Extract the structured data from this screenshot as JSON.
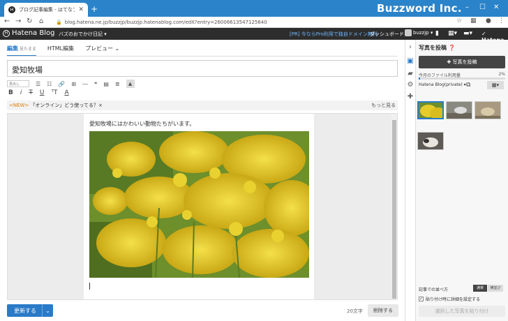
{
  "browser": {
    "tab_title": "ブログ記事編集 - はてなブログ",
    "new_tab": "+",
    "brand": "Buzzword Inc.",
    "url": "blog.hatena.ne.jp/buzzjp/buzzjp.hatenablog.com/edit?entry=26006613547125640"
  },
  "hatena": {
    "logo": "Hatena Blog",
    "blog_name": "バズのおでかけ日記 ▾",
    "pro_link": "[PR] 今ならPro利用で独自ドメイン無料",
    "dashboard": "ダッシュボード",
    "user": "buzzjp ▾",
    "brand": "Hatena"
  },
  "editor": {
    "tabs": [
      {
        "label": "編集",
        "sub": "見たまま"
      },
      {
        "label": "HTML編集"
      },
      {
        "label": "プレビュー ⌄"
      }
    ],
    "title": "愛知牧場",
    "heading_select": "見出し",
    "news_new": "<NEW>",
    "news_text": "「オンライン」どう使ってる？×",
    "news_more": "もっと見る",
    "body_text": "愛知牧場にはかわいい動物たちがいます。",
    "update_button": "更新する",
    "char_count": "20文字",
    "delete_button": "削除する"
  },
  "panel": {
    "title": "写真を投稿 ❓",
    "post_button": "✚ 写真を投稿",
    "usage_label": "今月のファイル利用量",
    "usage_value": "2%",
    "usage_fraction": 0.02,
    "album": "Hatena Blog(private) ▾",
    "sort_label": "記事での並べ方",
    "sort_options": [
      "通常",
      "横並び"
    ],
    "checkbox_label": "貼り付け時に詳細を設定する",
    "paste_button": "選択した写真を貼り付け"
  }
}
